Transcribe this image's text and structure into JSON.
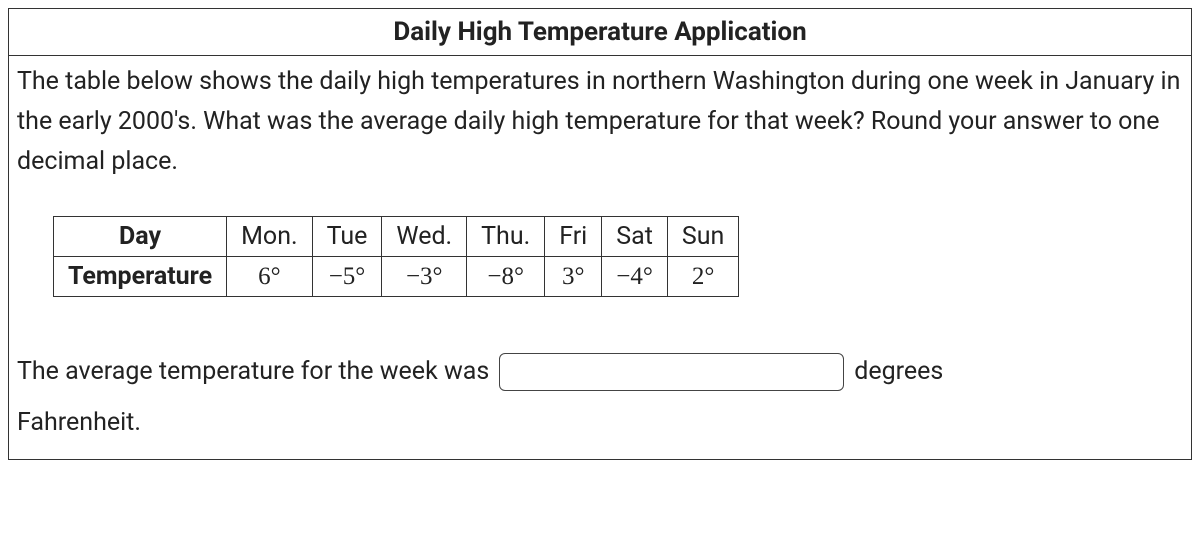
{
  "title": "Daily High Temperature Application",
  "question": "The table below shows the daily high temperatures in northern Washington during one week in January in the early 2000's. What was the average daily high temperature for that week? Round your answer to one decimal place.",
  "table": {
    "rowHeaders": [
      "Day",
      "Temperature"
    ],
    "days": [
      "Mon.",
      "Tue",
      "Wed.",
      "Thu.",
      "Fri",
      "Sat",
      "Sun"
    ],
    "temperatures": [
      "6°",
      "−5°",
      "−3°",
      "−8°",
      "3°",
      "−4°",
      "2°"
    ]
  },
  "answer": {
    "prefix": "The average temperature for the week was",
    "inputValue": "",
    "suffix1": "degrees",
    "suffix2": "Fahrenheit."
  }
}
